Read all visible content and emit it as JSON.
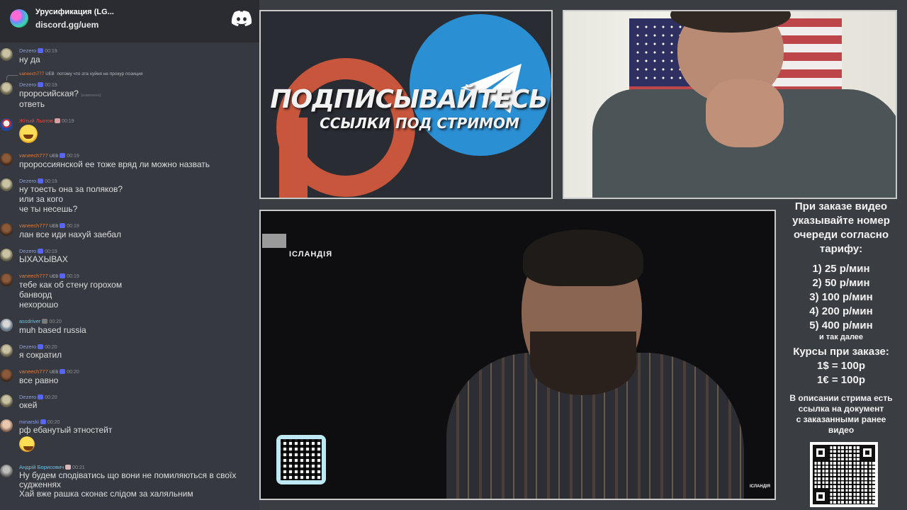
{
  "server": {
    "name": "Урусификация (LG...",
    "invite": "discord.gg/uem"
  },
  "chat": {
    "messages": [
      {
        "user": "Dezero",
        "time": "00:19",
        "lines": [
          "ну да"
        ],
        "color": "#8e9fe8"
      },
      {
        "reply_user": "vaneech777",
        "reply_tag": "UEB",
        "reply_text": "потому что эта хуйня не прокур позиция"
      },
      {
        "user": "Dezero",
        "time": "00:19",
        "lines": [
          "проросийская?",
          "ответь"
        ],
        "edited": "(изменено)",
        "color": "#8e9fe8"
      },
      {
        "user": "Жітый Льотов",
        "time": "00:19",
        "lines": [],
        "color": "#e24a4a"
      },
      {
        "user": "vaneech777",
        "tag": "UEB",
        "time": "00:19",
        "lines": [
          "пророссиянской ее тоже вряд ли можно назвать"
        ],
        "color": "#e07a3a"
      },
      {
        "user": "Dezero",
        "time": "00:19",
        "lines": [
          "ну тоесть она за поляков?",
          "или за кого",
          "че ты несешь?"
        ],
        "color": "#8e9fe8"
      },
      {
        "user": "vaneech777",
        "tag": "UEB",
        "time": "00:19",
        "lines": [
          "лан все иди нахуй заебал"
        ],
        "color": "#e07a3a"
      },
      {
        "user": "Dezero",
        "time": "00:19",
        "lines": [
          "ЫХАХЫВАХ"
        ],
        "color": "#8e9fe8"
      },
      {
        "user": "vaneech777",
        "tag": "UEB",
        "time": "00:19",
        "lines": [
          "тебе как об стену горохом",
          "банворд",
          "нехорошо"
        ],
        "color": "#e07a3a"
      },
      {
        "user": "assdriver",
        "time": "00:20",
        "lines": [
          "muh based russia"
        ],
        "color": "#6cc3e8"
      },
      {
        "user": "Dezero",
        "time": "00:20",
        "lines": [
          "я сократил"
        ],
        "color": "#8e9fe8"
      },
      {
        "user": "vaneech777",
        "tag": "UEB",
        "time": "00:20",
        "lines": [
          "все равно"
        ],
        "color": "#e07a3a"
      },
      {
        "user": "Dezero",
        "time": "00:20",
        "lines": [
          "окей"
        ],
        "color": "#8e9fe8"
      },
      {
        "user": "minarski",
        "time": "00:20",
        "lines": [
          "рф ебанутый этностейт"
        ],
        "color": "#8e9fe8"
      },
      {
        "user": "Андрій Борисович",
        "time": "00:21",
        "lines": [
          "Ну будем сподіватись що вони не помиляються в своїх",
          "судженнях",
          "Хай вже рашка сконає слідом за халяльним"
        ],
        "color": "#6cc3e8"
      }
    ]
  },
  "promo": {
    "title": "ПОДПИСЫВАЙТЕСЬ",
    "subtitle": "ССЫЛКИ ПОД СТРИМОМ"
  },
  "video": {
    "channel_label": "ІСЛАНДІЯ",
    "corner_label": "ІСЛАНДІЯ"
  },
  "info": {
    "intro": [
      "При заказе видео",
      "указывайте номер",
      "очереди согласно",
      "тарифу:"
    ],
    "tariffs": [
      "1) 25 р/мин",
      "2) 50 р/мин",
      "3) 100 р/мин",
      "4) 200 р/мин",
      "5) 400 р/мин"
    ],
    "etc": "и так далее",
    "rates_title": "Курсы при заказе:",
    "rates": [
      "1$ = 100р",
      "1€ = 100р"
    ],
    "footer": [
      "В описании стрима есть",
      "ссылка на документ",
      "с заказанными ранее",
      "видео"
    ]
  },
  "colors": {
    "discord_bg": "#36393f",
    "patreon": "#c8563c",
    "telegram": "#2b8fd4",
    "panel_border": "#c9c9c9"
  },
  "icons": {
    "discord": "discord-logo-icon",
    "telegram": "telegram-plane-icon",
    "patreon": "patreon-p-icon",
    "qr": "qr-code-icon"
  }
}
